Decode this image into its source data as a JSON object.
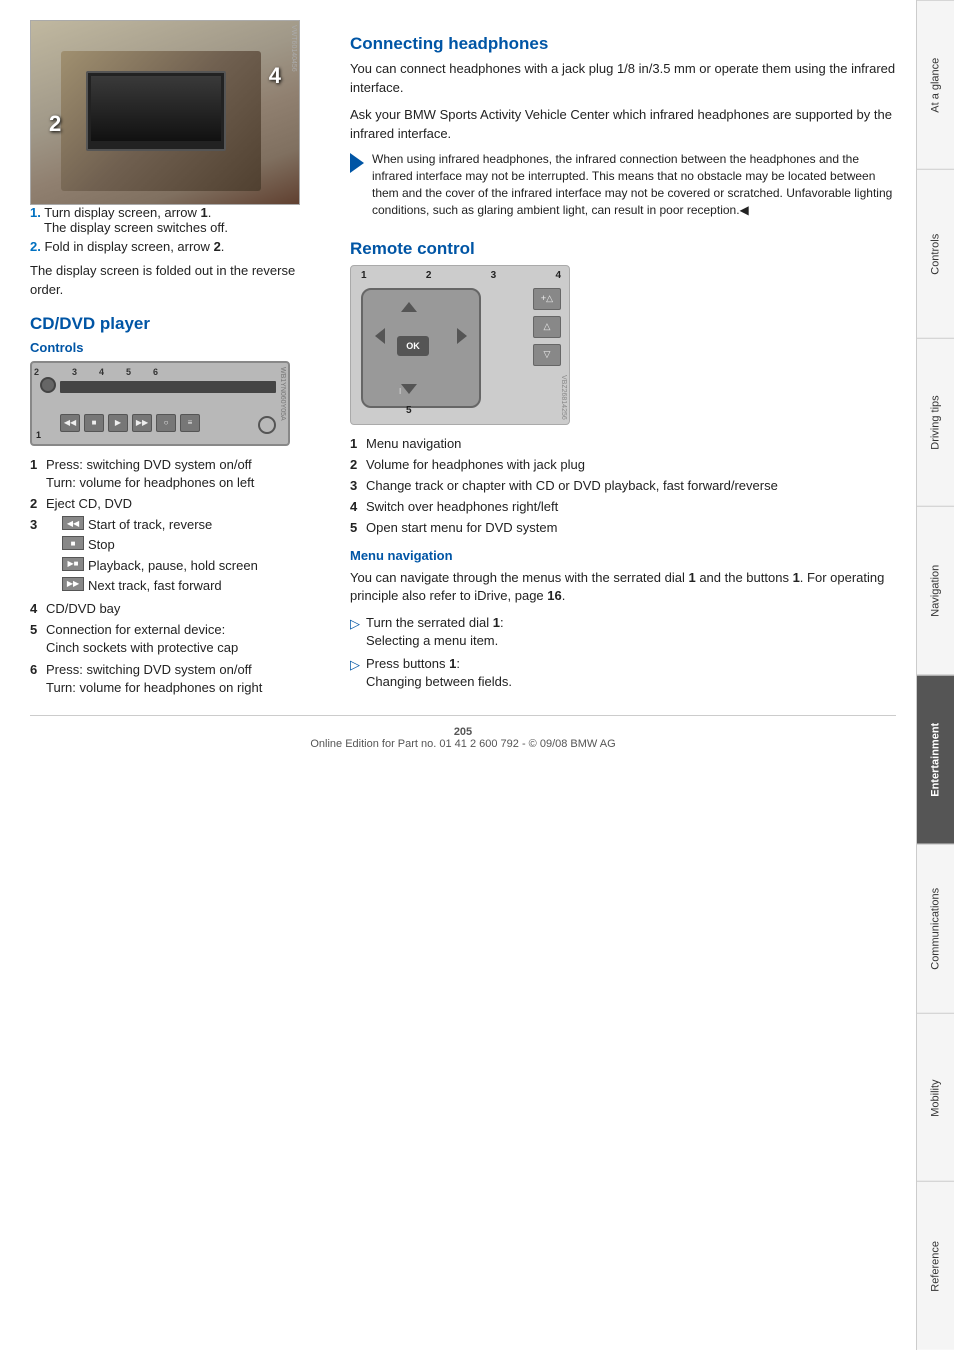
{
  "sidebar": {
    "tabs": [
      {
        "id": "at-a-glance",
        "label": "At a glance",
        "active": false
      },
      {
        "id": "controls",
        "label": "Controls",
        "active": false
      },
      {
        "id": "driving-tips",
        "label": "Driving tips",
        "active": false
      },
      {
        "id": "navigation",
        "label": "Navigation",
        "active": false
      },
      {
        "id": "entertainment",
        "label": "Entertainment",
        "active": true
      },
      {
        "id": "communications",
        "label": "Communications",
        "active": false
      },
      {
        "id": "mobility",
        "label": "Mobility",
        "active": false
      },
      {
        "id": "reference",
        "label": "Reference",
        "active": false
      }
    ]
  },
  "left_column": {
    "step1": "Turn display screen, arrow",
    "step1_bold": "1",
    "step1_sub": "The display screen switches off.",
    "step2": "Fold in display screen, arrow",
    "step2_bold": "2",
    "body_text": "The display screen is folded out in the reverse order.",
    "cd_section_title": "CD/DVD player",
    "controls_subtitle": "Controls",
    "cd_items": [
      {
        "num": "1",
        "desc": "Press: switching DVD system on/off\nTurn: volume for headphones on left"
      },
      {
        "num": "2",
        "desc": "Eject CD, DVD"
      },
      {
        "num": "3",
        "desc": "icons"
      },
      {
        "num": "4",
        "desc": "CD/DVD bay"
      },
      {
        "num": "5",
        "desc": "Connection for external device:\nCinch sockets with protective cap"
      },
      {
        "num": "6",
        "desc": "Press: switching DVD system on/off\nTurn: volume for headphones on right"
      }
    ],
    "cd_item_3_sub": [
      {
        "icon": "◀◀",
        "text": "Start of track, reverse"
      },
      {
        "icon": "■",
        "text": "Stop"
      },
      {
        "icon": "▶■",
        "text": "Playback, pause, hold screen"
      },
      {
        "icon": "▶▶",
        "text": "Next track, fast forward"
      }
    ]
  },
  "right_column": {
    "headphones_title": "Connecting headphones",
    "headphones_body1": "You can connect headphones with a jack plug 1/8 in/3.5 mm or operate them using the infrared interface.",
    "headphones_body2": "Ask your BMW Sports Activity Vehicle Center which infrared headphones are supported by the infrared interface.",
    "note_text": "When using infrared headphones, the infrared connection between the headphones and the infrared interface may not be interrupted. This means that no obstacle may be located between them and the cover of the infrared interface may not be covered or scratched. Unfavorable lighting conditions, such as glaring ambient light, can result in poor reception.◀",
    "remote_title": "Remote control",
    "remote_items": [
      {
        "num": "1",
        "desc": "Menu navigation"
      },
      {
        "num": "2",
        "desc": "Volume for headphones with jack plug"
      },
      {
        "num": "3",
        "desc": "Change track or chapter with CD or DVD playback, fast forward/reverse"
      },
      {
        "num": "4",
        "desc": "Switch over headphones right/left"
      },
      {
        "num": "5",
        "desc": "Open start menu for DVD system"
      }
    ],
    "menu_nav_subtitle": "Menu navigation",
    "menu_nav_body": "You can navigate through the menus with the serrated dial",
    "menu_nav_body2": "1 and the buttons 1. For operating principle also refer to iDrive, page",
    "menu_nav_page": "16",
    "menu_nav_page_suffix": ".",
    "arrow_items": [
      {
        "arrow": "▷",
        "label": "Turn the serrated dial",
        "bold_part": "1",
        "colon": ":",
        "sub": "Selecting a menu item."
      },
      {
        "arrow": "▷",
        "label": "Press buttons",
        "bold_part": "1",
        "colon": ":",
        "sub": "Changing between fields."
      }
    ]
  },
  "footer": {
    "page_number": "205",
    "footer_text": "Online Edition for Part no. 01 41 2 600 792 - © 09/08 BMW AG"
  },
  "remote_labels": {
    "top": [
      "1",
      "2",
      "3",
      "4"
    ],
    "bottom": "5"
  },
  "cdplayer_labels": {
    "numbers": [
      "3",
      "4",
      "5",
      "6"
    ],
    "left_label": "2",
    "bottom_left": "1"
  }
}
